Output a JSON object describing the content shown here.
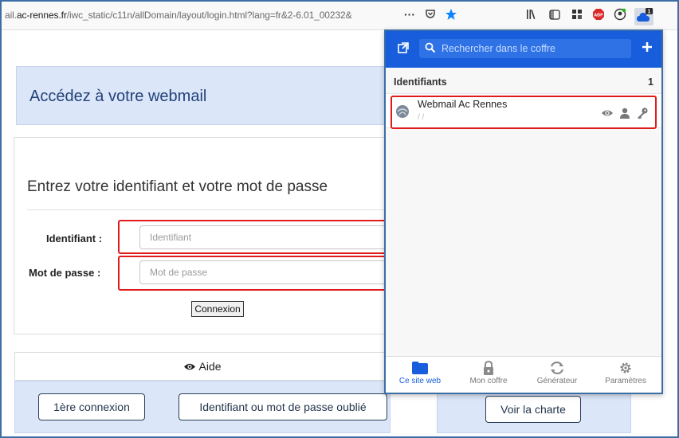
{
  "browser": {
    "url_prefix": "ail.",
    "url_domain": "ac-rennes.fr",
    "url_path": "/iwc_static/c11n/allDomain/layout/login.html?lang=fr&2-6.01_00232&",
    "page_actions_icon": "···",
    "bitwarden_badge": "1"
  },
  "page": {
    "title": "Accédez à votre webmail",
    "login_heading": "Entrez votre identifiant et votre mot de passe",
    "username_label": "Identifiant :",
    "username_placeholder": "Identifiant",
    "password_label": "Mot de passe :",
    "password_placeholder": "Mot de passe",
    "connect_button": "Connexion",
    "help_label": "Aide",
    "first_login_button": "1ère connexion",
    "forgot_button": "Identifiant ou mot de passe oublié",
    "charter_button": "Voir la charte"
  },
  "bitwarden": {
    "search_placeholder": "Rechercher dans le coffre",
    "section_title": "Identifiants",
    "section_count": "1",
    "items": [
      {
        "name": "Webmail Ac Rennes",
        "subtitle": "/ /"
      }
    ],
    "tabs": [
      {
        "label": "Ce site web",
        "icon": "folder-icon",
        "active": true
      },
      {
        "label": "Mon coffre",
        "icon": "lock-icon",
        "active": false
      },
      {
        "label": "Générateur",
        "icon": "refresh-icon",
        "active": false
      },
      {
        "label": "Paramètres",
        "icon": "gear-icon",
        "active": false
      }
    ],
    "accent_color": "#175ddc"
  },
  "colors": {
    "highlight": "#e01b1b",
    "panel_blue": "#dbe6f8",
    "heading_blue": "#23427a"
  }
}
